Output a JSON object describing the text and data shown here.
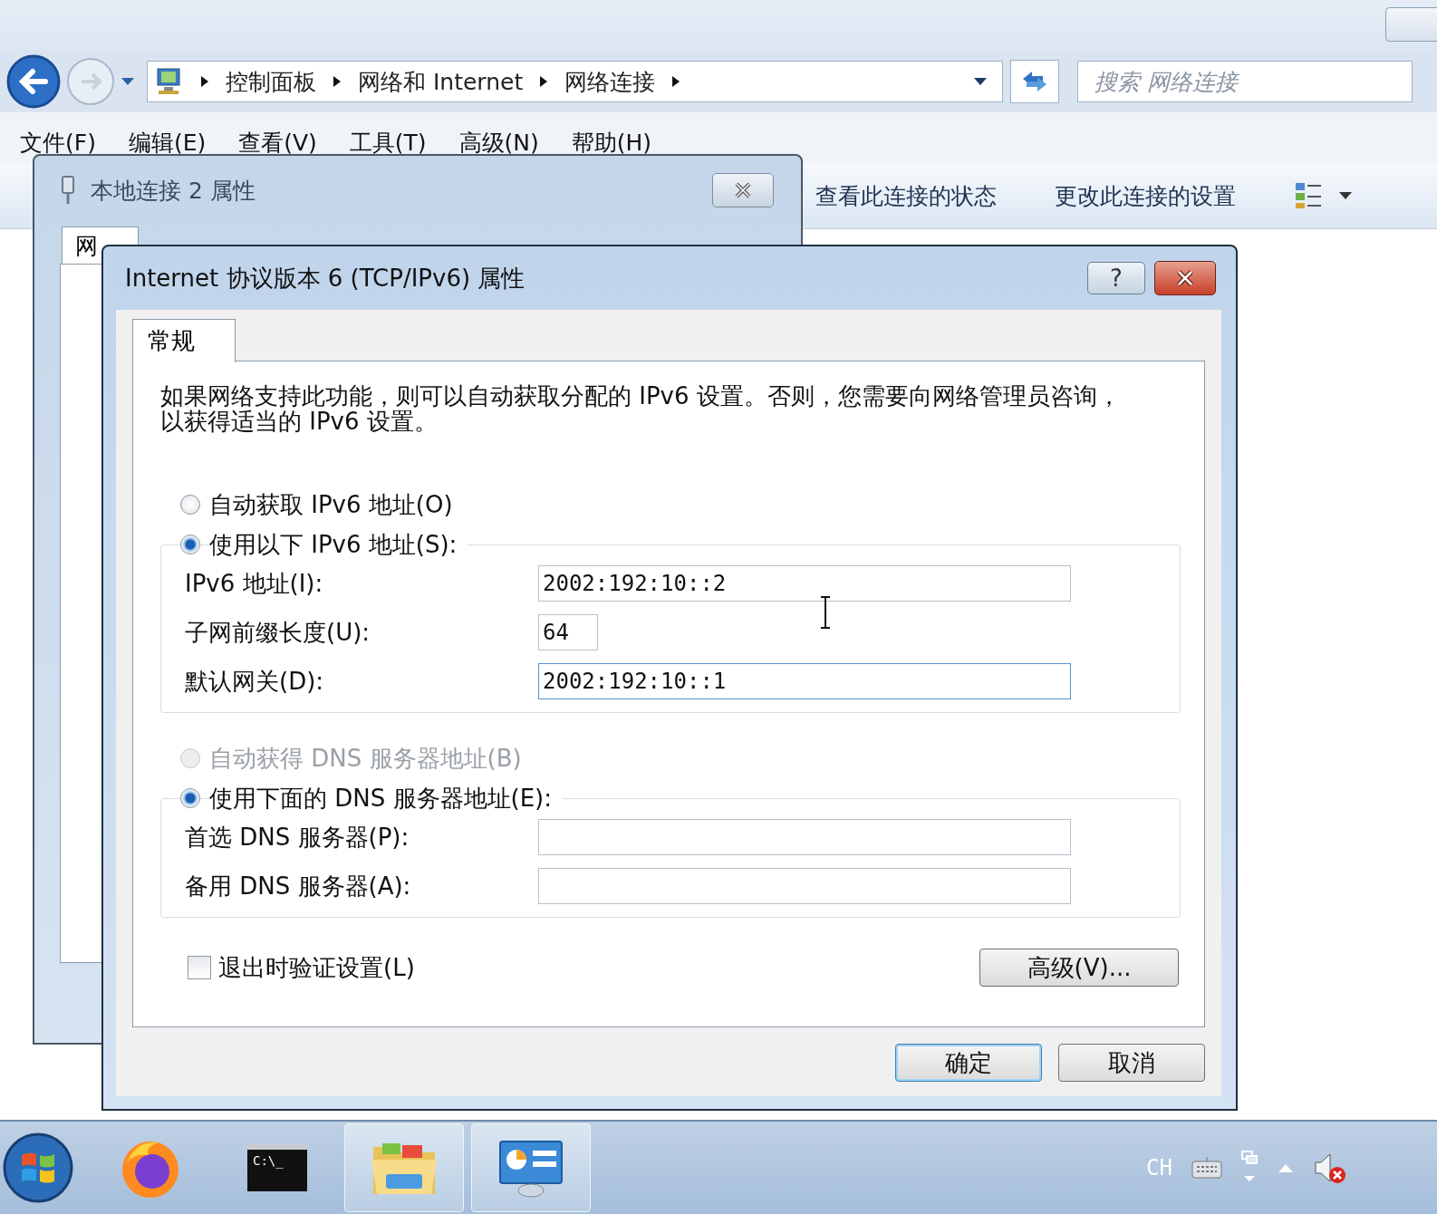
{
  "explorer": {
    "breadcrumb": [
      "控制面板",
      "网络和 Internet",
      "网络连接"
    ],
    "search": {
      "placeholder": "搜索 网络连接"
    },
    "menu": [
      "文件(F)",
      "编辑(E)",
      "查看(V)",
      "工具(T)",
      "高级(N)",
      "帮助(H)"
    ],
    "toolbar": [
      "查看此连接的状态",
      "更改此连接的设置"
    ]
  },
  "back_dialog": {
    "title": "本地连接 2 属性",
    "tabs": [
      {
        "label": "网",
        "selected": true
      }
    ]
  },
  "dialog": {
    "title": "Internet 协议版本 6 (TCP/IPv6) 属性",
    "help": "?",
    "tabs": [
      {
        "label": "常规",
        "selected": true
      }
    ],
    "intro": "如果网络支持此功能，则可以自动获取分配的 IPv6 设置。否则，您需要向网络管理员咨询，以获得适当的 IPv6 设置。",
    "ip_mode": [
      {
        "label": "自动获取 IPv6 地址(O)",
        "selected": false,
        "disabled": false
      },
      {
        "label": "使用以下 IPv6 地址(S):",
        "selected": true,
        "disabled": false
      }
    ],
    "ip_fields": [
      {
        "label": "IPv6 地址(I):",
        "value": "2002:192:10::2",
        "short": false,
        "focused": false
      },
      {
        "label": "子网前缀长度(U):",
        "value": "64",
        "short": true,
        "focused": false
      },
      {
        "label": "默认网关(D):",
        "value": "2002:192:10::1",
        "short": false,
        "focused": true
      }
    ],
    "dns_mode": [
      {
        "label": "自动获得 DNS 服务器地址(B)",
        "selected": false,
        "disabled": true
      },
      {
        "label": "使用下面的 DNS 服务器地址(E):",
        "selected": true,
        "disabled": false
      }
    ],
    "dns_fields": [
      {
        "label": "首选 DNS 服务器(P):"
      },
      {
        "label": "备用 DNS 服务器(A):"
      }
    ],
    "validate": {
      "label": "退出时验证设置(L)",
      "checked": false
    },
    "advanced": "高级(V)...",
    "buttons": [
      "确定",
      "取消"
    ]
  },
  "taskbar": {
    "apps": [
      {
        "kind": "firefox",
        "active": false
      },
      {
        "kind": "terminal",
        "text": "C:\\_",
        "active": false
      },
      {
        "kind": "folder",
        "active": true
      },
      {
        "kind": "control-panel",
        "active": true
      }
    ],
    "language": "CH"
  }
}
